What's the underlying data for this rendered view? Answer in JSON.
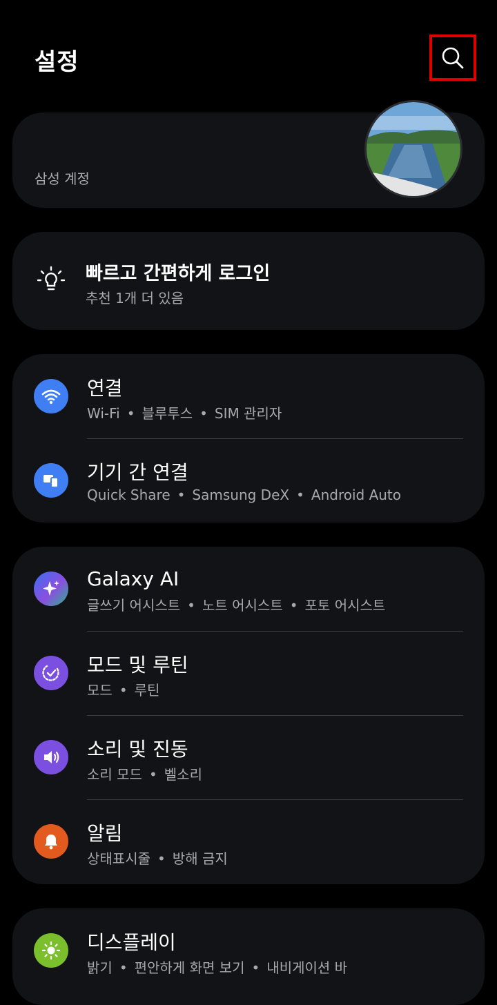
{
  "header": {
    "title": "설정"
  },
  "account": {
    "label": "삼성 계정"
  },
  "quick_login": {
    "title": "빠르고 간편하게 로그인",
    "subtitle": "추천 1개 더 있음"
  },
  "groups": [
    {
      "items": [
        {
          "title": "연결",
          "subs": [
            "Wi-Fi",
            "블루투스",
            "SIM 관리자"
          ],
          "icon": "wifi-icon",
          "color": "#3f7ff3"
        },
        {
          "title": "기기 간 연결",
          "subs": [
            "Quick Share",
            "Samsung DeX",
            "Android Auto"
          ],
          "icon": "devices-icon",
          "color": "#3f7ff3"
        }
      ]
    },
    {
      "items": [
        {
          "title": "Galaxy AI",
          "subs": [
            "글쓰기 어시스트",
            "노트 어시스트",
            "포토 어시스트"
          ],
          "icon": "sparkle-icon",
          "color": "#4a5ee8"
        },
        {
          "title": "모드 및 루틴",
          "subs": [
            "모드",
            "루틴"
          ],
          "icon": "routine-icon",
          "color": "#7b4fe0"
        },
        {
          "title": "소리 및 진동",
          "subs": [
            "소리 모드",
            "벨소리"
          ],
          "icon": "speaker-icon",
          "color": "#7b4fe0"
        },
        {
          "title": "알림",
          "subs": [
            "상태표시줄",
            "방해 금지"
          ],
          "icon": "bell-icon",
          "color": "#e25a1e"
        }
      ]
    },
    {
      "items": [
        {
          "title": "디스플레이",
          "subs": [
            "밝기",
            "편안하게 화면 보기",
            "내비게이션 바"
          ],
          "icon": "sun-icon",
          "color": "#7bc02c"
        }
      ]
    }
  ]
}
